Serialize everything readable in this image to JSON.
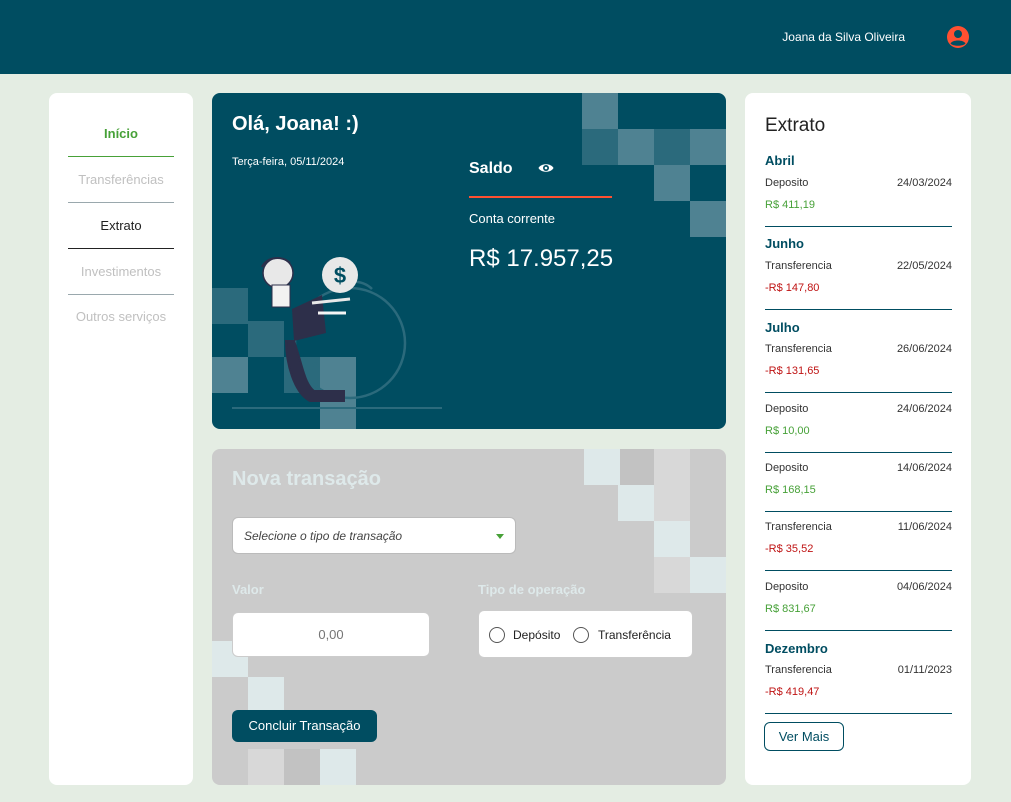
{
  "header": {
    "user_name": "Joana da Silva Oliveira",
    "avatar_icon": "user-circle-icon",
    "background": "#004d61",
    "avatar_color": "#ff5031"
  },
  "sidebar": {
    "items": [
      {
        "label": "Início"
      },
      {
        "label": "Transferências"
      },
      {
        "label": "Extrato"
      },
      {
        "label": "Investimentos"
      },
      {
        "label": "Outros serviços"
      }
    ]
  },
  "balance": {
    "greeting": "Olá, Joana! :)",
    "date": "Terça-feira, 05/11/2024",
    "saldo_label": "Saldo",
    "eye_icon": "eye-icon",
    "account_label": "Conta corrente",
    "value": "R$ 17.957,25"
  },
  "transaction": {
    "title": "Nova transação",
    "select_placeholder": "Selecione o tipo de transação",
    "valor_label": "Valor",
    "valor_placeholder": "0,00",
    "operation_label": "Tipo de operação",
    "options": [
      "Depósito",
      "Transferência"
    ],
    "submit_label": "Concluir Transação"
  },
  "extrato": {
    "title": "Extrato",
    "groups": [
      {
        "month": "Abril",
        "entries": [
          {
            "type": "Deposito",
            "date": "24/03/2024",
            "amount": "R$ 411,19"
          }
        ]
      },
      {
        "month": "Junho",
        "entries": [
          {
            "type": "Transferencia",
            "date": "22/05/2024",
            "amount": "-R$ 147,80"
          }
        ]
      },
      {
        "month": "Julho",
        "entries": [
          {
            "type": "Transferencia",
            "date": "26/06/2024",
            "amount": "-R$ 131,65"
          },
          {
            "type": "Deposito",
            "date": "24/06/2024",
            "amount": "R$ 10,00"
          },
          {
            "type": "Deposito",
            "date": "14/06/2024",
            "amount": "R$ 168,15"
          },
          {
            "type": "Transferencia",
            "date": "11/06/2024",
            "amount": "-R$ 35,52"
          },
          {
            "type": "Deposito",
            "date": "04/06/2024",
            "amount": "R$ 831,67"
          }
        ]
      },
      {
        "month": "Dezembro",
        "entries": [
          {
            "type": "Transferencia",
            "date": "01/11/2023",
            "amount": "-R$ 419,47"
          }
        ]
      }
    ],
    "more_label": "Ver Mais"
  }
}
